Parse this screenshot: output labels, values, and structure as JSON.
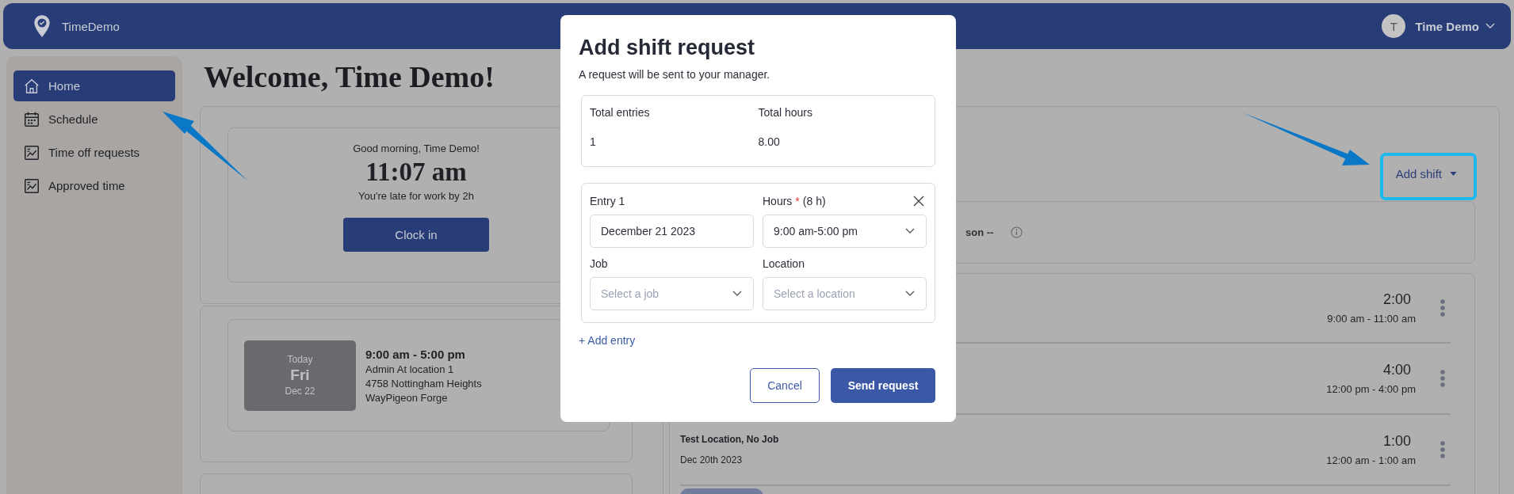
{
  "app": {
    "name": "TimeDemo",
    "user_initial": "T",
    "user_name": "Time Demo"
  },
  "sidebar": {
    "items": [
      {
        "label": "Home",
        "selected": true
      },
      {
        "label": "Schedule",
        "selected": false
      },
      {
        "label": "Time off requests",
        "selected": false
      },
      {
        "label": "Approved time",
        "selected": false
      }
    ]
  },
  "welcome": "Welcome, Time Demo!",
  "clock_card": {
    "greeting": "Good morning, Time Demo!",
    "time": "11:07 am",
    "status": "You're late for work by 2h",
    "button": "Clock in"
  },
  "shift_card": {
    "day_label": "Today",
    "weekday": "Fri",
    "date": "Dec 22",
    "time_range": "9:00 am - 5:00 pm",
    "lines": [
      "Admin At location 1",
      "4758 Nottingham Heights",
      "WayPigeon Forge"
    ]
  },
  "timesheet": {
    "add_button": "Add shift",
    "summary_text": "son --",
    "entries": [
      {
        "duration": "2:00",
        "range": "9:00 am - 11:00 am"
      },
      {
        "duration": "4:00",
        "range": "12:00 pm - 4:00 pm"
      },
      {
        "title": "Test Location, No Job",
        "date": "Dec 20th 2023",
        "duration": "1:00",
        "range": "12:00 am - 1:00 am"
      }
    ]
  },
  "modal": {
    "title": "Add shift request",
    "subtitle": "A request will be sent to your manager.",
    "summary": [
      {
        "label": "Total entries",
        "value": "1"
      },
      {
        "label": "Total hours",
        "value": "8.00"
      }
    ],
    "entry": {
      "title": "Entry 1",
      "hours_label": "Hours",
      "required_mark": "*",
      "hours_hint": "(8 h)",
      "date_value": "December 21 2023",
      "hours_value": "9:00 am-5:00 pm",
      "job_label": "Job",
      "job_placeholder": "Select a job",
      "location_label": "Location",
      "location_placeholder": "Select a location"
    },
    "add_entry": "+ Add entry",
    "cancel": "Cancel",
    "submit": "Send request"
  }
}
